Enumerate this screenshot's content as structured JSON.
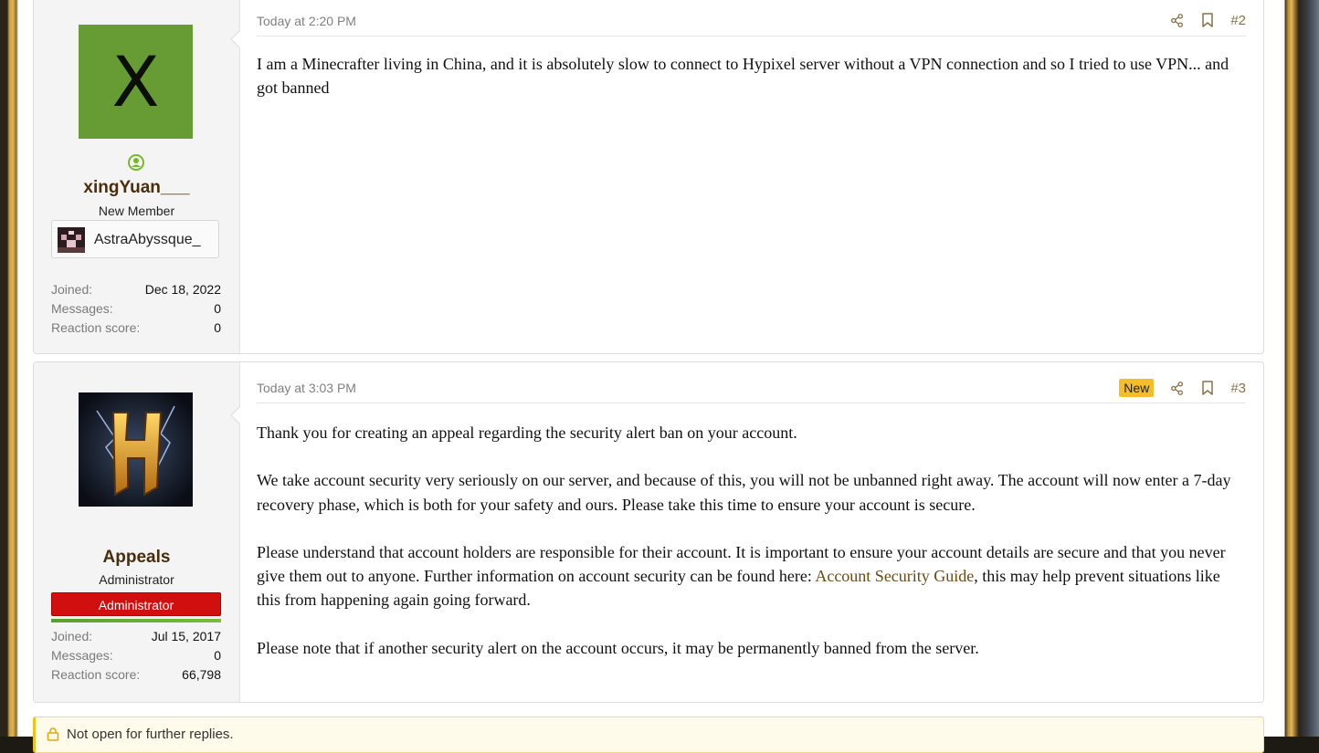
{
  "posts": [
    {
      "date": "Today at 2:20 PM",
      "post_number": "#2",
      "username": "xingYuan___",
      "user_title": "New Member",
      "avatar_letter": "X",
      "linked_account": "AstraAbyssque_",
      "stats": [
        {
          "label": "Joined:",
          "value": "Dec 18, 2022"
        },
        {
          "label": "Messages:",
          "value": "0"
        },
        {
          "label": "Reaction score:",
          "value": "0"
        }
      ],
      "body": [
        "I am a Minecrafter living in China, and it is absolutely slow to connect to Hypixel server without a VPN connection and so I tried to use VPN... and got banned"
      ]
    },
    {
      "date": "Today at 3:03 PM",
      "badge": "New",
      "post_number": "#3",
      "username": "Appeals",
      "user_title": "Administrator",
      "user_banner": "Administrator",
      "stats": [
        {
          "label": "Joined:",
          "value": "Jul 15, 2017"
        },
        {
          "label": "Messages:",
          "value": "0"
        },
        {
          "label": "Reaction score:",
          "value": "66,798"
        }
      ],
      "body_p1": "Thank you for creating an appeal regarding the security alert ban on your account.",
      "body_p2": "We take account security very seriously on our server, and because of this, you will not be unbanned right away. The account will now enter a 7-day recovery phase, which is both for your safety and ours. Please take this time to ensure your account is secure.",
      "body_p3_before": "Please understand that account holders are responsible for their account. It is important to ensure your account details are secure and that you never give them out to anyone. Further information on account security can be found here: ",
      "body_p3_link": "Account Security Guide",
      "body_p3_after": ", this may help prevent situations like this from happening again going forward.",
      "body_p4": "Please note that if another security alert on the account occurs, it may be permanently banned from the server."
    }
  ],
  "notice": "Not open for further replies.",
  "colors": {
    "username": "#4a2d0b",
    "accent_link": "#6b4a18",
    "admin_banner": "#d10f0f",
    "new_badge": "#f3bd2c",
    "avatar_green": "#679c35"
  },
  "icons": [
    "online-status-icon",
    "share-icon",
    "bookmark-icon",
    "lock-icon"
  ]
}
